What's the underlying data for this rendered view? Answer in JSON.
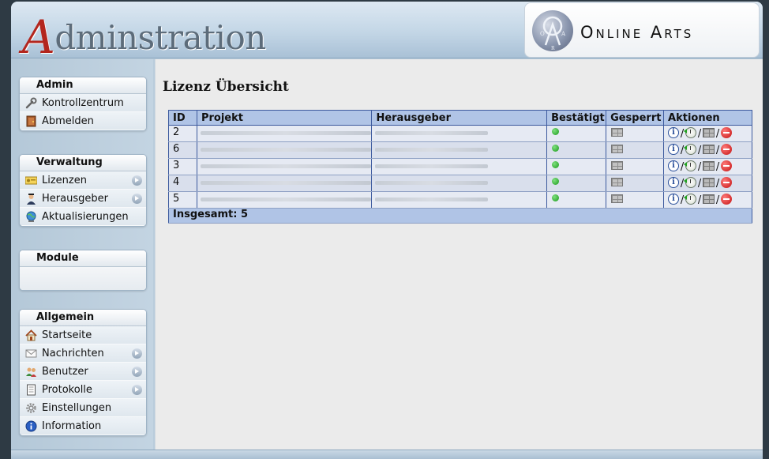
{
  "header": {
    "title_first": "A",
    "title_rest": "dminstration",
    "logo_text": "Online Arts",
    "logo_letters": [
      "O",
      "R",
      "A"
    ]
  },
  "sidebar": {
    "admin": {
      "title": "Admin",
      "items": [
        {
          "label": "Kontrollzentrum",
          "icon": "wrench-icon"
        },
        {
          "label": "Abmelden",
          "icon": "door-icon"
        }
      ]
    },
    "verwaltung": {
      "title": "Verwaltung",
      "items": [
        {
          "label": "Lizenzen",
          "icon": "license-key-icon"
        },
        {
          "label": "Herausgeber",
          "icon": "publisher-person-icon"
        },
        {
          "label": "Aktualisierungen",
          "icon": "globe-update-icon"
        }
      ]
    },
    "module": {
      "title": "Module"
    },
    "allgemein": {
      "title": "Allgemein",
      "items": [
        {
          "label": "Startseite",
          "icon": "home-icon"
        },
        {
          "label": "Nachrichten",
          "icon": "envelope-icon"
        },
        {
          "label": "Benutzer",
          "icon": "users-icon"
        },
        {
          "label": "Protokolle",
          "icon": "notebook-icon"
        },
        {
          "label": "Einstellungen",
          "icon": "gear-icon"
        },
        {
          "label": "Information",
          "icon": "info-icon"
        }
      ]
    }
  },
  "main": {
    "title": "Lizenz Übersicht",
    "table": {
      "columns": [
        "ID",
        "Projekt",
        "Herausgeber",
        "Bestätigt",
        "Gesperrt",
        "Aktionen"
      ],
      "rows": [
        {
          "id": "2",
          "bestaetigt": "green-dot-icon",
          "gesperrt": "wall-icon"
        },
        {
          "id": "6",
          "bestaetigt": "green-dot-icon",
          "gesperrt": "wall-icon"
        },
        {
          "id": "3",
          "bestaetigt": "green-dot-icon",
          "gesperrt": "wall-icon"
        },
        {
          "id": "4",
          "bestaetigt": "green-dot-icon",
          "gesperrt": "wall-icon"
        },
        {
          "id": "5",
          "bestaetigt": "green-dot-icon",
          "gesperrt": "wall-icon"
        }
      ],
      "action_separator": "/",
      "actions": [
        "info-icon",
        "history-clock-icon",
        "lock-wall-icon",
        "delete-icon"
      ],
      "footer": "Insgesamt: 5"
    }
  },
  "colors": {
    "brand_red": "#b3261e",
    "table_header": "#b0c4e6",
    "table_border": "#3d5a9e",
    "confirmed_green": "#1b9a1b",
    "delete_red": "#c41212"
  }
}
